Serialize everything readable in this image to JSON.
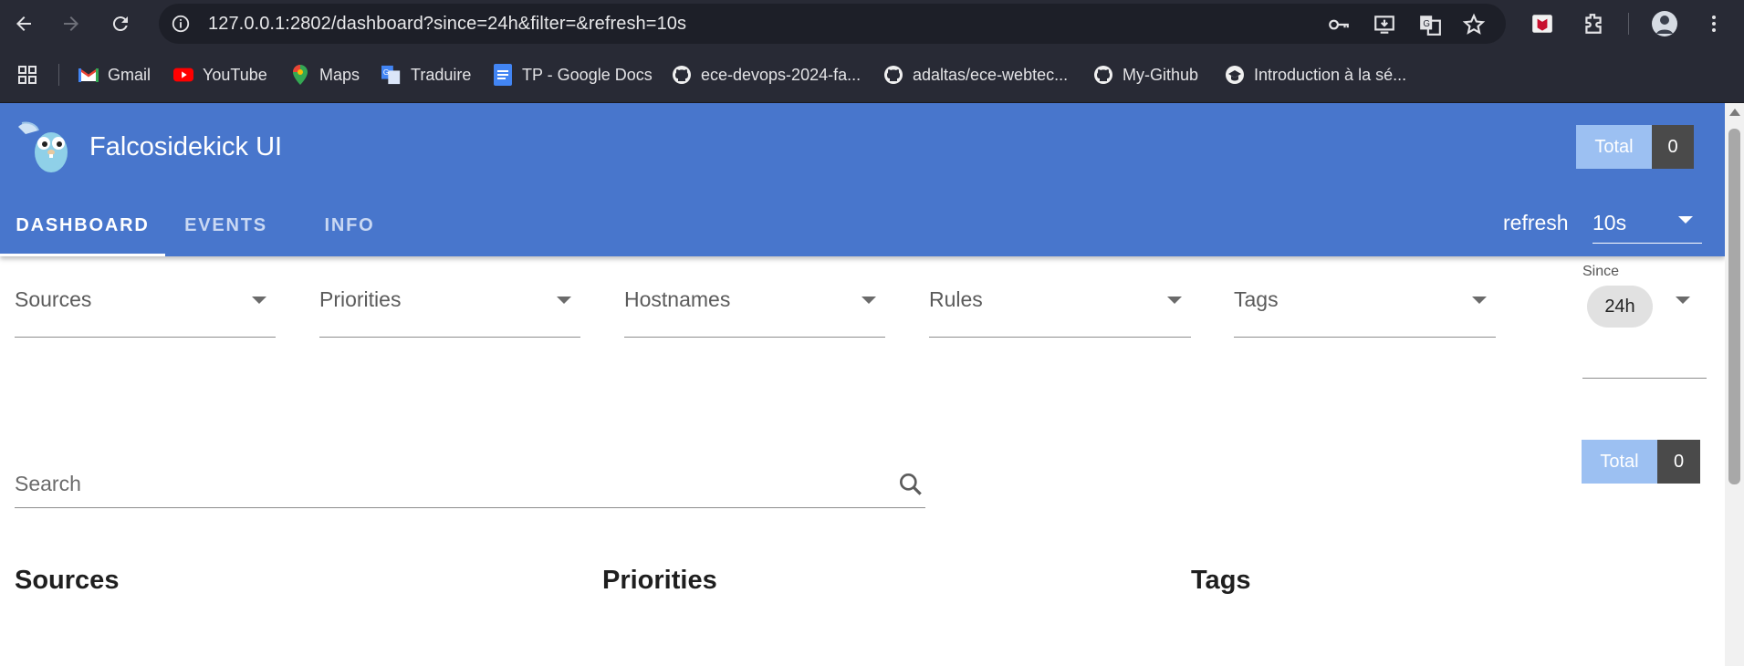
{
  "browser": {
    "url": "127.0.0.1:2802/dashboard?since=24h&filter=&refresh=10s",
    "bookmarks": [
      {
        "label": "Gmail",
        "icon": "gmail-icon"
      },
      {
        "label": "YouTube",
        "icon": "youtube-icon"
      },
      {
        "label": "Maps",
        "icon": "maps-icon"
      },
      {
        "label": "Traduire",
        "icon": "translate-icon"
      },
      {
        "label": "TP - Google Docs",
        "icon": "docs-icon"
      },
      {
        "label": "ece-devops-2024-fa...",
        "icon": "github-icon"
      },
      {
        "label": "adaltas/ece-webtec...",
        "icon": "github-icon"
      },
      {
        "label": "My-Github",
        "icon": "github-icon"
      },
      {
        "label": "Introduction à la sé...",
        "icon": "hat-icon"
      }
    ]
  },
  "app": {
    "title": "Falcosidekick UI",
    "total_label": "Total",
    "total_value": "0",
    "tabs": [
      {
        "label": "DASHBOARD",
        "active": true
      },
      {
        "label": "EVENTS",
        "active": false
      },
      {
        "label": "INFO",
        "active": false
      }
    ],
    "refresh_label": "refresh",
    "refresh_value": "10s"
  },
  "filters": {
    "sources": "Sources",
    "priorities": "Priorities",
    "hostnames": "Hostnames",
    "rules": "Rules",
    "tags": "Tags",
    "since_label": "Since",
    "since_value": "24h"
  },
  "search": {
    "placeholder": "Search",
    "total_label": "Total",
    "total_value": "0"
  },
  "sections": {
    "sources": "Sources",
    "priorities": "Priorities",
    "tags": "Tags"
  },
  "colors": {
    "app_bar": "#4876cc",
    "total_label_bg": "#9cc0f2",
    "total_value_bg": "#4a4a4a",
    "chrome_bg": "#282a35"
  }
}
